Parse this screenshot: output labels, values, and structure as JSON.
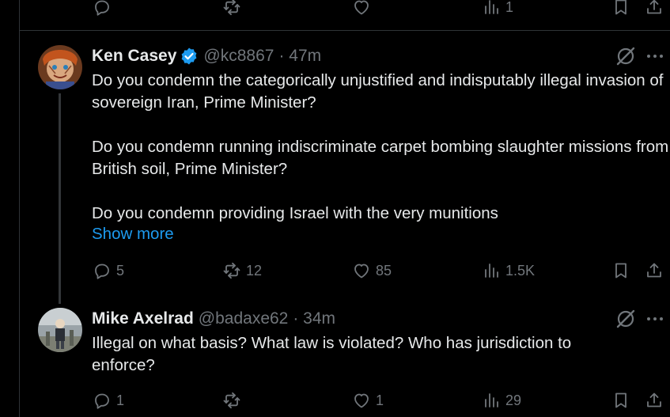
{
  "previous_tweet": {
    "actions": {
      "replies": "",
      "reposts": "",
      "likes": "",
      "views": "1"
    }
  },
  "tweets": [
    {
      "name": "Ken Casey",
      "handle": "@kc8867",
      "time": "· 47m",
      "verified": true,
      "paragraphs": [
        "Do you condemn the categorically unjustified and indisputably illegal invasion of sovereign Iran, Prime Minister?",
        "Do you condemn running indiscriminate carpet bombing slaughter missions from British soil, Prime Minister?",
        "Do you condemn providing Israel with the very munitions"
      ],
      "show_more": "Show more",
      "actions": {
        "replies": "5",
        "reposts": "12",
        "likes": "85",
        "views": "1.5K"
      }
    },
    {
      "name": "Mike Axelrad",
      "handle": "@badaxe62",
      "time": "· 34m",
      "verified": false,
      "paragraphs": [
        "Illegal on what basis?  What law is violated?  Who has jurisdiction to enforce?"
      ],
      "actions": {
        "replies": "1",
        "reposts": "",
        "likes": "1",
        "views": "29"
      }
    }
  ],
  "colors": {
    "background": "#000000",
    "text": "#e7e9ea",
    "muted": "#71767b",
    "link": "#1d9bf0",
    "verified": "#1d9bf0",
    "divider": "#2f3336"
  },
  "icons": [
    "reply-icon",
    "repost-icon",
    "like-icon",
    "views-icon",
    "bookmark-icon",
    "share-icon",
    "grok-icon",
    "more-icon",
    "verified-badge-icon"
  ]
}
